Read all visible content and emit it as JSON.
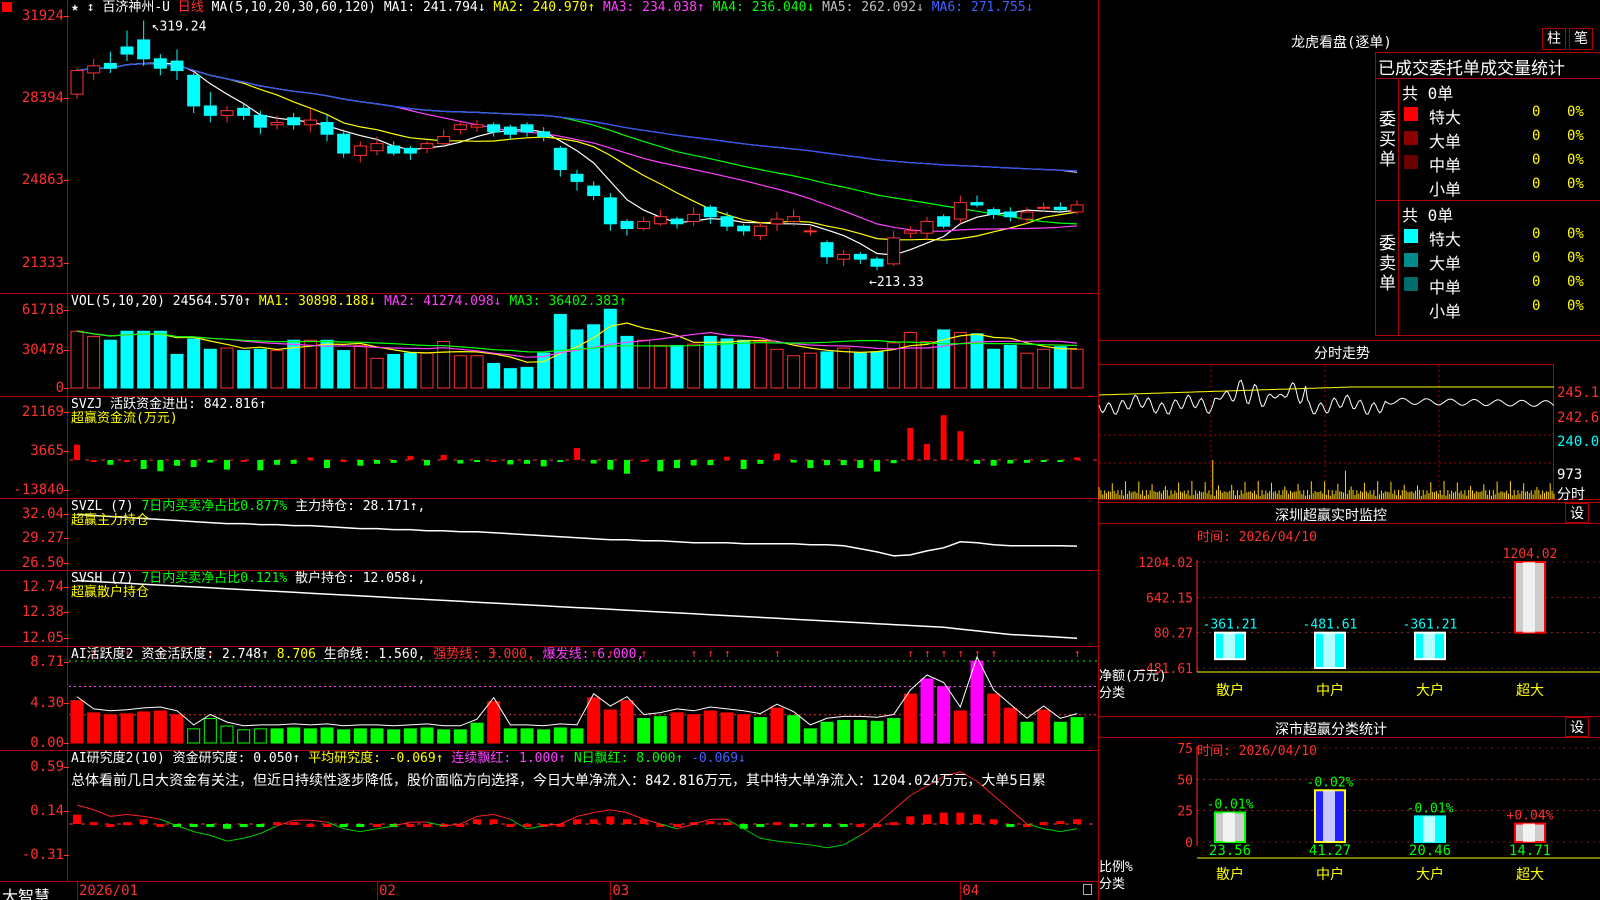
{
  "brand": "大智慧",
  "stock": {
    "name": "百济神州-U",
    "period": "日线"
  },
  "price_pane": {
    "ma_label": "MA(5,10,20,30,60,120)",
    "ma1": "MA1: 241.794↓",
    "ma2": "MA2: 240.970↑",
    "ma3": "MA3: 234.038↑",
    "ma4": "MA4: 236.040↓",
    "ma5": "MA5: 262.092↓",
    "ma6": "MA6: 271.755↓",
    "ticks": [
      "31924",
      "28394",
      "24863",
      "21333"
    ],
    "high_label": "319.24",
    "low_label": "←213.33",
    "candles": [
      [
        288,
        298,
        286,
        299
      ],
      [
        297,
        300,
        294,
        303
      ],
      [
        301,
        299,
        297,
        306
      ],
      [
        308,
        305,
        302,
        315
      ],
      [
        311,
        303,
        300,
        319.24
      ],
      [
        303,
        299,
        296,
        305
      ],
      [
        302,
        298,
        294,
        307
      ],
      [
        296,
        283,
        280,
        297
      ],
      [
        283,
        279,
        276,
        289
      ],
      [
        279,
        281,
        276,
        283
      ],
      [
        282,
        279,
        277,
        284
      ],
      [
        279,
        274,
        271,
        281
      ],
      [
        275,
        276,
        273,
        279
      ],
      [
        278,
        275,
        273,
        280
      ],
      [
        275,
        277,
        272,
        282
      ],
      [
        276,
        271,
        268,
        279
      ],
      [
        271,
        263,
        261,
        273
      ],
      [
        262,
        266,
        259,
        268
      ],
      [
        264,
        267,
        262,
        270
      ],
      [
        266,
        263,
        262,
        268
      ],
      [
        265,
        263,
        260,
        266
      ],
      [
        265,
        267,
        263,
        268
      ],
      [
        267,
        270,
        266,
        273
      ],
      [
        273,
        275,
        271,
        276
      ],
      [
        274,
        275,
        272,
        277
      ],
      [
        275,
        272,
        270,
        276
      ],
      [
        274,
        271,
        269,
        275
      ],
      [
        275,
        272,
        270,
        276
      ],
      [
        272,
        270,
        268,
        274
      ],
      [
        265,
        256,
        253,
        266
      ],
      [
        254,
        251,
        247,
        256
      ],
      [
        249,
        245,
        243,
        251
      ],
      [
        244,
        233,
        230,
        246
      ],
      [
        234,
        231,
        228,
        235
      ],
      [
        231,
        234,
        230,
        236
      ],
      [
        233,
        236,
        232,
        239
      ],
      [
        235,
        233,
        231,
        236
      ],
      [
        234,
        237,
        232,
        240
      ],
      [
        240,
        236,
        233,
        241
      ],
      [
        236,
        232,
        230,
        238
      ],
      [
        232,
        230,
        228,
        233
      ],
      [
        228,
        232,
        226,
        234
      ],
      [
        233,
        235,
        230,
        238
      ],
      [
        234,
        236,
        232,
        239
      ],
      [
        230,
        230,
        228,
        232
      ],
      [
        225,
        219,
        216,
        226
      ],
      [
        218,
        220,
        215,
        222
      ],
      [
        220,
        218,
        216,
        221
      ],
      [
        218,
        215,
        213.33,
        219
      ],
      [
        216,
        227,
        215,
        230
      ],
      [
        229,
        230,
        227,
        232
      ],
      [
        229,
        234,
        226,
        236
      ],
      [
        236,
        232,
        231,
        237
      ],
      [
        235,
        242,
        233,
        245
      ],
      [
        242,
        241,
        240,
        245
      ],
      [
        239,
        237,
        235,
        240
      ],
      [
        238,
        236,
        234,
        240
      ],
      [
        235,
        238,
        233,
        240
      ],
      [
        240,
        240,
        238,
        242
      ],
      [
        240,
        239,
        238,
        242
      ],
      [
        238,
        241,
        237,
        243
      ]
    ]
  },
  "vol_pane": {
    "label": "VOL(5,10,20)",
    "value": "24564.570↑",
    "ma1": "MA1: 30898.188↓",
    "ma2": "MA2: 41274.098↓",
    "ma3": "MA3: 36402.383↑",
    "ticks": [
      "61718",
      "30478",
      "0"
    ],
    "values": [
      44,
      40,
      37,
      44,
      44,
      44,
      26,
      38,
      30,
      31,
      29,
      30,
      29,
      37,
      37,
      37,
      29,
      33,
      23,
      26,
      27,
      27,
      36,
      25,
      25,
      19,
      15,
      16,
      27,
      57,
      45,
      49,
      61,
      40,
      37,
      33,
      33,
      34,
      40,
      38,
      37,
      36,
      30,
      25,
      27,
      28,
      31,
      27,
      28,
      35,
      43,
      36,
      45,
      43,
      42,
      30,
      33,
      27,
      30,
      32,
      30
    ]
  },
  "svzj_pane": {
    "label": "SVZJ",
    "name": "活跃资金进出:",
    "value": "842.816↑",
    "subtitle": "超赢资金流(万元)",
    "ticks": [
      "21169",
      "3665",
      "-13840"
    ],
    "values": [
      4800,
      0,
      -1500,
      0,
      -2800,
      -3500,
      -1800,
      -2200,
      -800,
      -3000,
      0,
      -3200,
      -1500,
      -1200,
      800,
      -2500,
      0,
      -1800,
      -1200,
      -900,
      1300,
      -1700,
      1600,
      -1100,
      -300,
      0,
      -1400,
      -1200,
      -2000,
      -600,
      3700,
      -1100,
      -3000,
      -4300,
      0,
      -3500,
      -2500,
      -1700,
      -1600,
      1000,
      -2800,
      -1200,
      2000,
      -800,
      -2500,
      -1600,
      -1600,
      -2500,
      -3600,
      -1000,
      10000,
      5000,
      14000,
      9000,
      -1200,
      -1800,
      -1100,
      -900,
      -500,
      -200,
      842
    ]
  },
  "svzl_pane": {
    "label": "SVZL (7)",
    "text1": "7日内买卖净占比0.877%",
    "name": "主力持仓:",
    "value": "28.171↑,",
    "subtitle": "超赢主力持仓",
    "ticks": [
      "32.04",
      "29.27",
      "26.50"
    ],
    "values": [
      31.3,
      31.2,
      31.1,
      31.0,
      30.9,
      30.8,
      30.7,
      30.6,
      30.5,
      30.4,
      30.4,
      30.3,
      30.3,
      30.2,
      30.2,
      30.1,
      30.0,
      29.9,
      29.9,
      29.8,
      29.8,
      29.7,
      29.7,
      29.6,
      29.6,
      29.5,
      29.4,
      29.3,
      29.2,
      29.1,
      29.0,
      28.9,
      28.8,
      28.8,
      28.7,
      28.7,
      28.6,
      28.5,
      28.5,
      28.5,
      28.4,
      28.4,
      28.4,
      28.4,
      28.3,
      28.3,
      28.2,
      27.9,
      27.6,
      27.2,
      27.3,
      27.7,
      28.0,
      28.6,
      28.5,
      28.3,
      28.2,
      28.2,
      28.2,
      28.2,
      28.17
    ]
  },
  "svsh_pane": {
    "label": "SVSH (7)",
    "text1": "7日内买卖净占比0.121%",
    "name": "散户持仓:",
    "value": "12.058↓,",
    "subtitle": "超赢散户持仓",
    "ticks": [
      "12.74",
      "12.38",
      "12.05"
    ],
    "values": [
      12.7,
      12.69,
      12.68,
      12.67,
      12.66,
      12.65,
      12.64,
      12.63,
      12.62,
      12.61,
      12.6,
      12.59,
      12.58,
      12.57,
      12.56,
      12.55,
      12.54,
      12.53,
      12.52,
      12.51,
      12.5,
      12.49,
      12.48,
      12.47,
      12.46,
      12.45,
      12.44,
      12.43,
      12.42,
      12.41,
      12.4,
      12.39,
      12.38,
      12.37,
      12.36,
      12.35,
      12.34,
      12.33,
      12.32,
      12.31,
      12.3,
      12.29,
      12.28,
      12.27,
      12.26,
      12.25,
      12.24,
      12.23,
      12.22,
      12.21,
      12.2,
      12.19,
      12.18,
      12.16,
      12.14,
      12.12,
      12.1,
      12.09,
      12.08,
      12.07,
      12.058
    ]
  },
  "ai_active_pane": {
    "label": "AI活跃度2",
    "name": "资金活跃度:",
    "value": "2.748↑",
    "v2": "8.706",
    "life_label": "生命线:",
    "life_value": "1.560,",
    "strong_label": "强势线: 3.000,",
    "burst_label": "爆发线: 6.000,",
    "ticks": [
      "8.71",
      "4.30",
      "0.00"
    ],
    "values": [
      4.5,
      3.2,
      3.0,
      3.1,
      3.3,
      3.4,
      3.0,
      1.5,
      2.6,
      1.8,
      1.4,
      1.5,
      1.5,
      1.6,
      1.5,
      1.6,
      1.4,
      1.5,
      1.5,
      1.4,
      1.5,
      1.6,
      1.4,
      1.4,
      2.1,
      4.4,
      1.5,
      1.5,
      1.4,
      1.6,
      1.5,
      4.8,
      3.5,
      4.5,
      2.6,
      2.8,
      3.2,
      3.0,
      3.4,
      3.2,
      3.0,
      2.7,
      3.7,
      2.9,
      1.5,
      2.2,
      2.4,
      2.4,
      2.3,
      2.6,
      5.2,
      6.8,
      6.0,
      3.4,
      8.7,
      5.2,
      3.7,
      2.2,
      3.5,
      2.2,
      2.7
    ],
    "up_flags": [
      0,
      1,
      0,
      1,
      0,
      1,
      0,
      0,
      1,
      0,
      0,
      0,
      0,
      0,
      0,
      0,
      0,
      0,
      0,
      0,
      0,
      0,
      0,
      0,
      0,
      1,
      0,
      0,
      0,
      0,
      0,
      1,
      1,
      0,
      1,
      0,
      0,
      1,
      1,
      1,
      0,
      0,
      1,
      0,
      0,
      0,
      0,
      0,
      0,
      0,
      1,
      1,
      1,
      1,
      1,
      1,
      0,
      0,
      0,
      0,
      1
    ]
  },
  "ai_research_pane": {
    "label": "AI研究度2(10)",
    "name": "资金研究度:",
    "value": "0.050↑",
    "avg_label": "平均研究度: -0.069↑",
    "red_label": "连续飘红: 1.000↑",
    "n_red_label": "N日飘红: 8.000↑",
    "last_label": "-0.069↓",
    "comment": "总体看前几日大资金有关注，但近日持续性逐步降低，股价面临方向选择，今日大单净流入：842.816万元，其中特大单净流入：1204.024万元，大单5日累",
    "ticks": [
      "0.59",
      "0.14",
      "-0.31"
    ],
    "values": [
      0.1,
      0.02,
      0.0,
      0.02,
      0.05,
      0.0,
      -0.02,
      -0.02,
      -0.02,
      -0.05,
      -0.02,
      -0.02,
      0.02,
      0.02,
      0.0,
      0.0,
      -0.02,
      -0.03,
      0.0,
      -0.02,
      0.0,
      0.0,
      0.0,
      0.0,
      0.05,
      0.05,
      0.0,
      0.0,
      0.0,
      0.0,
      0.05,
      0.05,
      0.08,
      0.05,
      0.05,
      0.0,
      0.0,
      0.02,
      0.03,
      0.02,
      -0.05,
      -0.03,
      0.02,
      -0.03,
      -0.03,
      -0.03,
      -0.03,
      0.0,
      0.0,
      0.02,
      0.08,
      0.1,
      0.12,
      0.12,
      0.1,
      0.05,
      -0.02,
      0.0,
      0.02,
      0.03,
      0.05
    ],
    "line": [
      0.2,
      0.15,
      0.08,
      0.1,
      0.08,
      0.05,
      -0.02,
      -0.08,
      -0.12,
      -0.18,
      -0.15,
      -0.1,
      -0.02,
      0.04,
      0.04,
      0.02,
      -0.05,
      -0.08,
      -0.05,
      -0.02,
      0.02,
      0.02,
      -0.02,
      0.0,
      0.08,
      0.1,
      0.05,
      -0.05,
      -0.02,
      0.0,
      0.08,
      0.12,
      0.15,
      0.12,
      0.05,
      0.0,
      -0.05,
      0.0,
      0.05,
      0.05,
      -0.05,
      -0.15,
      -0.18,
      -0.2,
      -0.22,
      -0.25,
      -0.22,
      -0.12,
      0.0,
      0.15,
      0.3,
      0.4,
      0.5,
      0.55,
      0.45,
      0.3,
      0.15,
      0.0,
      -0.05,
      -0.08,
      -0.05
    ]
  },
  "x_axis": {
    "labels": [
      "2026/01",
      "02",
      "03",
      "04"
    ],
    "positions": [
      0,
      18,
      32,
      53
    ]
  },
  "right_panel": {
    "title": "龙虎看盘(逐单)",
    "btn_bar": "柱",
    "btn_pen": "笔",
    "stats_title": "已成交委托单成交量统计",
    "buy_side": "委买单",
    "sell_side": "委卖单",
    "buy_total": "共 0单",
    "sell_total": "共 0单",
    "rows": [
      {
        "label": "特大",
        "count": "0",
        "pct": "0%"
      },
      {
        "label": "大单",
        "count": "0",
        "pct": "0%"
      },
      {
        "label": "中单",
        "count": "0",
        "pct": "0%"
      },
      {
        "label": "小单",
        "count": "0",
        "pct": "0%"
      }
    ],
    "buy_colors": [
      "#ff0000",
      "#8b0000",
      "#6b0000",
      "#000000"
    ],
    "sell_colors": [
      "#00ffff",
      "#008b8b",
      "#006b6b",
      "#000000"
    ],
    "intraday_title": "分时走势",
    "intraday_ticks": [
      "245.1",
      "242.6",
      "240.0",
      "973"
    ],
    "intraday_fen": "分时",
    "monitor_title": "深圳超赢实时监控",
    "monitor_btn": "设",
    "monitor_time": "时间: 2026/04/10",
    "monitor_ticks": [
      "1204.02",
      "642.15",
      "80.27",
      "-481.61"
    ],
    "monitor_ylabel": "净额(万元)",
    "monitor_xlabel": "分类",
    "monitor_values": [
      -361.21,
      -481.61,
      -361.21,
      1204.02
    ],
    "monitor_value_labels": [
      "-361.21",
      "-481.61",
      "-361.21",
      "1204.02"
    ],
    "categories": [
      "散户",
      "中户",
      "大户",
      "超大"
    ],
    "class_title": "深市超赢分类统计",
    "class_btn": "设",
    "class_time": "时间: 2026/04/10",
    "class_ticks": [
      "75",
      "50",
      "25",
      "0"
    ],
    "class_ylabel": "比例%",
    "class_xlabel": "分类",
    "class_values": [
      23.56,
      41.27,
      20.46,
      14.71
    ],
    "class_value_labels": [
      "23.56",
      "41.27",
      "20.46",
      "14.71"
    ],
    "class_change_labels": [
      "-0.01%",
      "-0.02%",
      "-0.01%",
      "+0.04%"
    ]
  }
}
